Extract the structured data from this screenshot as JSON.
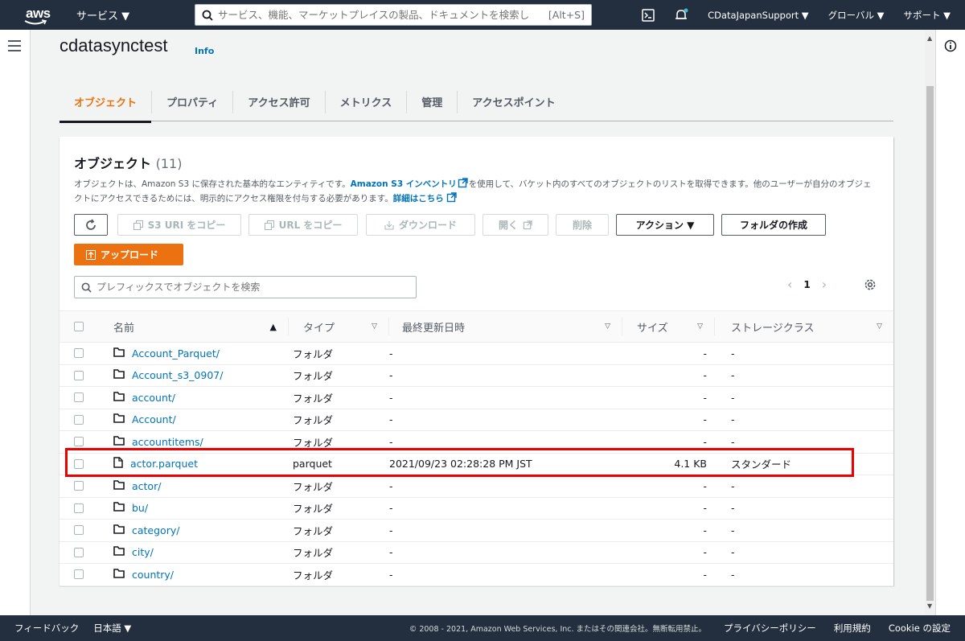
{
  "topbar": {
    "logo_text": "aws",
    "services_label": "サービス ▼",
    "search_placeholder": "サービス、機能、マーケットプレイスの製品、ドキュメントを検索し",
    "search_shortcut": "[Alt+S]",
    "account": "CDataJapanSupport ▼",
    "region": "グローバル ▼",
    "support": "サポート ▼"
  },
  "page": {
    "title": "cdatasynctest",
    "info_link": "Info"
  },
  "tabs": [
    "オブジェクト",
    "プロパティ",
    "アクセス許可",
    "メトリクス",
    "管理",
    "アクセスポイント"
  ],
  "objects_panel": {
    "heading": "オブジェクト",
    "count": "(11)",
    "desc_1": "オブジェクトは、Amazon S3 に保存された基本的なエンティティです。",
    "desc_link_1": "Amazon S3 インベントリ",
    "desc_2": "を使用して、バケット内のすべてのオブジェクトのリストを取得できます。他のユーザーが自分のオブジェクトにアクセスできるためには、明示的にアクセス権限を付与する必要があります。",
    "desc_link_2": "詳細はこちら",
    "buttons": {
      "copy_s3_uri": "S3 URI をコピー",
      "copy_url": "URL をコピー",
      "download": "ダウンロード",
      "open": "開く",
      "delete": "削除",
      "actions": "アクション ▼",
      "create_folder": "フォルダの作成",
      "upload": "アップロード"
    },
    "filter_placeholder": "プレフィックスでオブジェクトを検索",
    "page_number": "1"
  },
  "table": {
    "columns": [
      "名前",
      "タイプ",
      "最終更新日時",
      "サイズ",
      "ストレージクラス"
    ],
    "rows": [
      {
        "name": "Account_Parquet/",
        "type": "フォルダ",
        "modified": "-",
        "size": "-",
        "storage": "-",
        "icon": "folder"
      },
      {
        "name": "Account_s3_0907/",
        "type": "フォルダ",
        "modified": "-",
        "size": "-",
        "storage": "-",
        "icon": "folder"
      },
      {
        "name": "account/",
        "type": "フォルダ",
        "modified": "-",
        "size": "-",
        "storage": "-",
        "icon": "folder"
      },
      {
        "name": "Account/",
        "type": "フォルダ",
        "modified": "-",
        "size": "-",
        "storage": "-",
        "icon": "folder"
      },
      {
        "name": "accountitems/",
        "type": "フォルダ",
        "modified": "-",
        "size": "-",
        "storage": "-",
        "icon": "folder"
      },
      {
        "name": "actor.parquet",
        "type": "parquet",
        "modified": "2021/09/23 02:28:28 PM JST",
        "size": "4.1 KB",
        "storage": "スタンダード",
        "icon": "file"
      },
      {
        "name": "actor/",
        "type": "フォルダ",
        "modified": "-",
        "size": "-",
        "storage": "-",
        "icon": "folder"
      },
      {
        "name": "bu/",
        "type": "フォルダ",
        "modified": "-",
        "size": "-",
        "storage": "-",
        "icon": "folder"
      },
      {
        "name": "category/",
        "type": "フォルダ",
        "modified": "-",
        "size": "-",
        "storage": "-",
        "icon": "folder"
      },
      {
        "name": "city/",
        "type": "フォルダ",
        "modified": "-",
        "size": "-",
        "storage": "-",
        "icon": "folder"
      },
      {
        "name": "country/",
        "type": "フォルダ",
        "modified": "-",
        "size": "-",
        "storage": "-",
        "icon": "folder"
      }
    ]
  },
  "footer": {
    "feedback": "フィードバック",
    "language": "日本語 ▼",
    "copyright": "© 2008 - 2021, Amazon Web Services, Inc. またはその関連会社。無断転用禁止。",
    "privacy": "プライバシーポリシー",
    "terms": "利用規約",
    "cookies": "Cookie の設定"
  },
  "colors": {
    "accent": "#ec7211",
    "link": "#0073bb",
    "navbar": "#232f3e",
    "highlight": "#e00000"
  }
}
